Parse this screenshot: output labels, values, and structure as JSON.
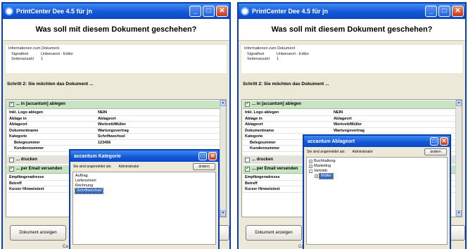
{
  "app_title": "PrintCenter Dee 4.5 für jn",
  "header_question": "Was soll mit diesem Dokument geschehen?",
  "info": {
    "title": "Informationen zum Dokument",
    "rows": [
      {
        "label": "Signalfest",
        "value": "Unbenannt - Editor"
      },
      {
        "label": "Seitenanzahl",
        "value": "1"
      }
    ]
  },
  "step_heading": "Schritt 2: Sie möchten das Dokument ...",
  "section_archive": "... in [accantum] ablegen",
  "properties": [
    {
      "label": "Inkl. Logo ablegen",
      "value": "NEIN"
    },
    {
      "label": "Ablage in",
      "value": "Ablageort"
    },
    {
      "label": "Ablageort",
      "value": "Werkrett/Müller"
    },
    {
      "label": "Dokumentname",
      "value": "Wartungsvertrag"
    },
    {
      "label": "Kategorie",
      "value": "Schriftwechsel"
    },
    {
      "label": "Belegnummer",
      "value": "123456",
      "indent": true
    },
    {
      "label": "Kundennummer",
      "value": "",
      "indent": true
    }
  ],
  "section_print": "... drucken",
  "section_email": "... per Email versenden",
  "email_properties": [
    {
      "label": "Empfängeradresse",
      "value": ""
    },
    {
      "label": "Betreff",
      "value": ""
    },
    {
      "label": "Kurzer Hinweistext",
      "value": ""
    }
  ],
  "show_document_button": "Dokument anzeigen",
  "bottom_text": "Ca",
  "dialog_category": {
    "title": "accantum Kategorie",
    "logged_in_as": "Sie sind angemeldet als:",
    "user": "Administrator",
    "change_button": "ändern",
    "items": [
      "Auftrag",
      "Lieferschein",
      "Rechnung",
      "Schriftwechsel"
    ],
    "selected": "Schriftwechsel"
  },
  "dialog_location": {
    "title": "accantum Ablageort",
    "logged_in_as": "Sie sind angemeldet als:",
    "user": "Administrator",
    "change_button": "ändern",
    "tree": [
      {
        "label": "Buchhaltung",
        "toggle": "+",
        "level": 0
      },
      {
        "label": "Marketing",
        "toggle": "+",
        "level": 0
      },
      {
        "label": "Vertrieb",
        "toggle": "-",
        "level": 0
      },
      {
        "label": "Müller",
        "toggle": "+",
        "level": 1,
        "selected": true
      }
    ]
  },
  "icons": {
    "app": "printcenter-icon",
    "minimize": "minimize-icon",
    "maximize": "maximize-icon",
    "close": "close-icon"
  },
  "colors": {
    "titlebar": "#1358d8",
    "section_green": "#c9e4c3",
    "selection": "#316ac5"
  }
}
